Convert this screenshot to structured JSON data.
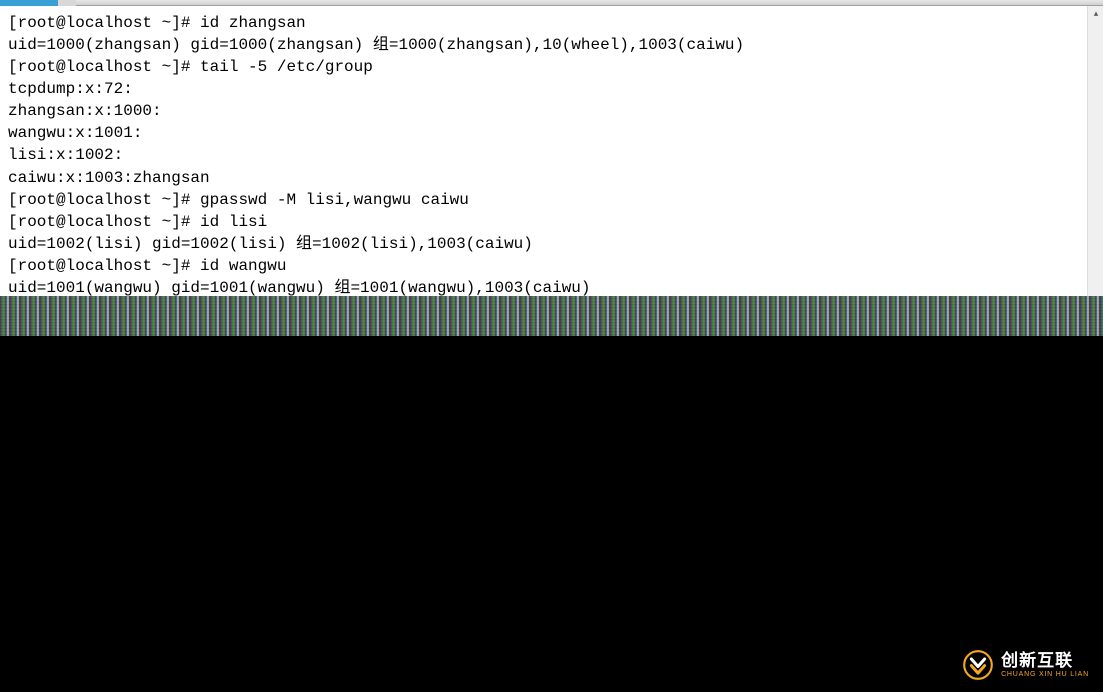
{
  "terminal": {
    "lines": [
      "[root@localhost ~]# id zhangsan",
      "uid=1000(zhangsan) gid=1000(zhangsan) 组=1000(zhangsan),10(wheel),1003(caiwu)",
      "[root@localhost ~]# tail -5 /etc/group",
      "tcpdump:x:72:",
      "zhangsan:x:1000:",
      "wangwu:x:1001:",
      "lisi:x:1002:",
      "caiwu:x:1003:zhangsan",
      "[root@localhost ~]# gpasswd -M lisi,wangwu caiwu",
      "[root@localhost ~]# id lisi",
      "uid=1002(lisi) gid=1002(lisi) 组=1002(lisi),1003(caiwu)",
      "[root@localhost ~]# id wangwu",
      "uid=1001(wangwu) gid=1001(wangwu) 组=1001(wangwu),1003(caiwu)"
    ]
  },
  "watermark": {
    "main": "创新互联",
    "sub": "CHUANG XIN HU LIAN"
  },
  "scrollbar": {
    "up_glyph": "▴"
  }
}
